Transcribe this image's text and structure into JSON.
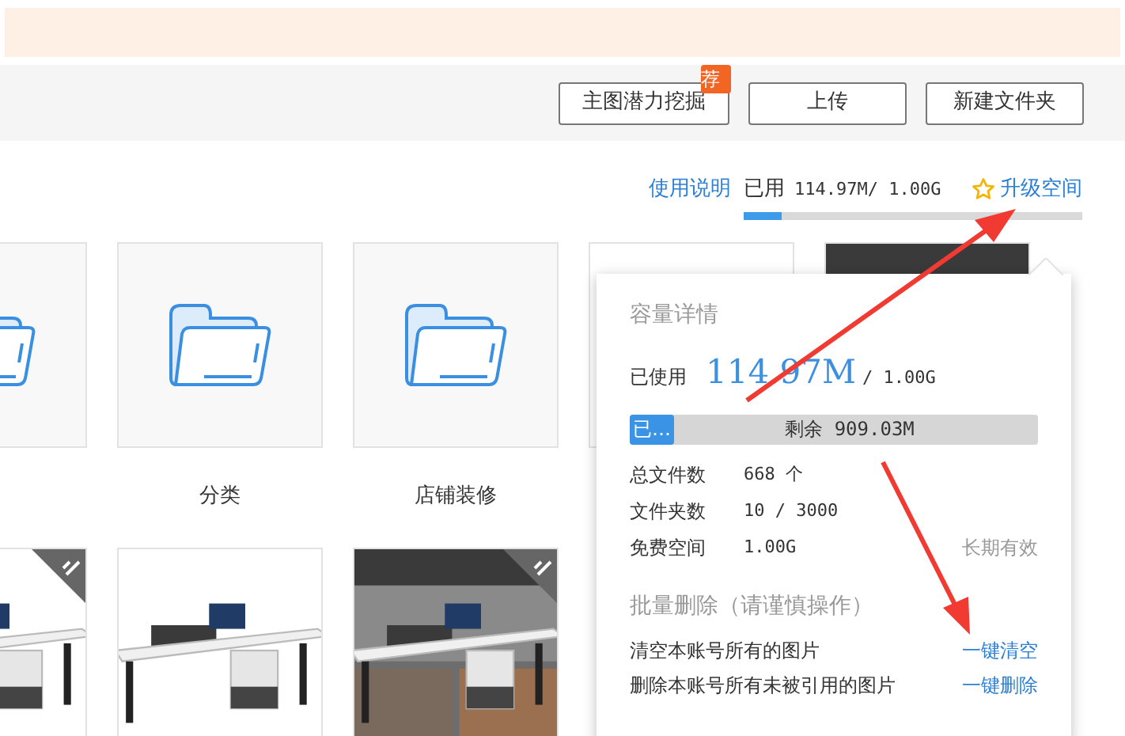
{
  "toolbar": {
    "buttons": [
      {
        "label": "主图潜力挖掘",
        "badge": "荐"
      },
      {
        "label": "上传"
      },
      {
        "label": "新建文件夹"
      }
    ]
  },
  "usage": {
    "help_link": "使用说明",
    "used_label": "已用",
    "used_value": "114.97M/ 1.00G",
    "level": 0.11,
    "upgrade_link": "升级空间"
  },
  "tiles": [
    {
      "kind": "folder"
    },
    {
      "kind": "folder",
      "label": "分类"
    },
    {
      "kind": "folder",
      "label": "店铺装修"
    },
    {
      "kind": "covered"
    },
    {
      "kind": "picture"
    },
    {
      "kind": "picture",
      "corner_mark": true
    },
    {
      "kind": "picture",
      "corner_mark": false
    },
    {
      "kind": "picture",
      "corner_mark": true
    }
  ],
  "popup": {
    "title": "容量详情",
    "used_label": "已使用",
    "used_value": "114.97M",
    "total": "/ 1.00G",
    "bar": {
      "level": 0.11,
      "fill_text": "已…",
      "remain_text": "剩余 909.03M"
    },
    "stats": [
      {
        "label": "总文件数",
        "value": "668 个"
      },
      {
        "label": "文件夹数",
        "value": "10 / 3000"
      },
      {
        "label": "免费空间",
        "value": "1.00G",
        "note": "长期有效"
      }
    ],
    "batch_title": "批量删除（请谨慎操作）",
    "actions": [
      {
        "text": "清空本账号所有的图片",
        "link": "一键清空"
      },
      {
        "text": "删除本账号所有未被引用的图片",
        "link": "一键删除"
      }
    ]
  }
}
